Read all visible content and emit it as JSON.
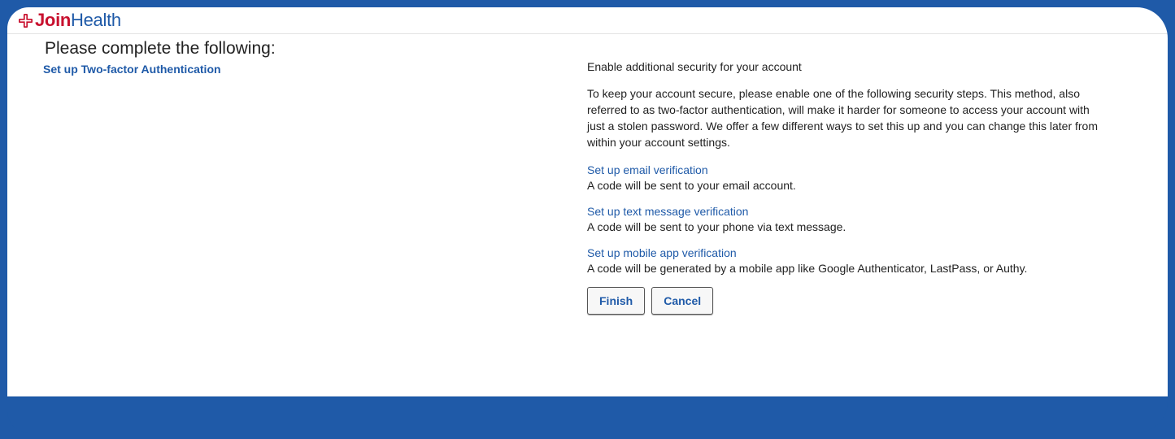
{
  "brand": {
    "name_part1": "Join",
    "name_part2": "Health",
    "logo_icon": "cross-logo-icon",
    "colors": {
      "primary_blue": "#1f5aa8",
      "brand_red": "#c8102e"
    }
  },
  "page": {
    "title": "Please complete the following:",
    "steps": [
      {
        "label": "Set up Two-factor Authentication"
      }
    ]
  },
  "content": {
    "heading": "Enable additional security for your account",
    "intro": "To keep your account secure, please enable one of the following security steps. This method, also referred to as two-factor authentication, will make it harder for someone to access your account with just a stolen password. We offer a few different ways to set this up and you can change this later from within your account settings.",
    "options": [
      {
        "link": "Set up email verification",
        "description": "A code will be sent to your email account."
      },
      {
        "link": "Set up text message verification",
        "description": "A code will be sent to your phone via text message."
      },
      {
        "link": "Set up mobile app verification",
        "description": "A code will be generated by a mobile app like Google Authenticator, LastPass, or Authy."
      }
    ]
  },
  "actions": {
    "finish_label": "Finish",
    "cancel_label": "Cancel"
  }
}
